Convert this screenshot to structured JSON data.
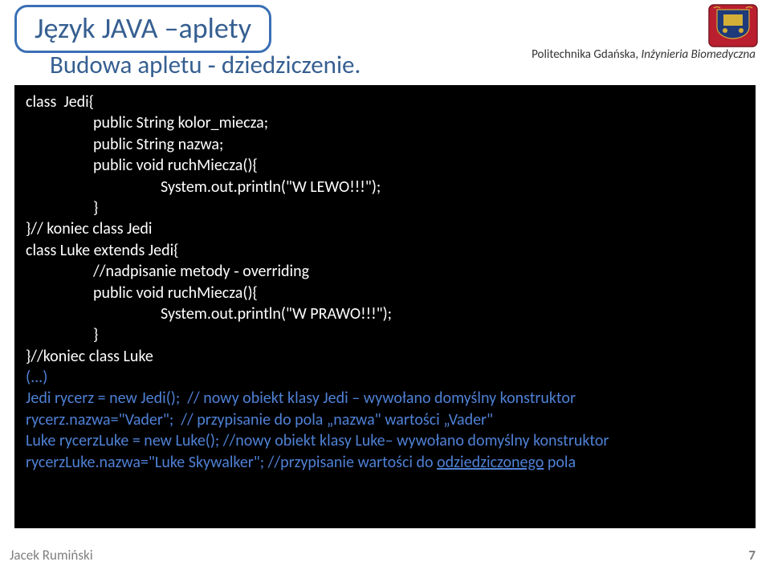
{
  "title": "Język JAVA –aplety",
  "subtitle": "Budowa apletu ‑ dziedziczenie.",
  "institution_plain": "Politechnika Gdańska, ",
  "institution_italic": "Inżynieria Biomedyczna",
  "code": {
    "l1": "class  Jedi{",
    "l2": "public String kolor_miecza;",
    "l3": "public String nazwa;",
    "l4": "public void ruchMiecza(){",
    "l5": "System.out.println(\"W LEWO!!!\");",
    "l6": "}",
    "l7": "}// koniec class Jedi",
    "l8": "class Luke extends Jedi{",
    "l9": "//nadpisanie metody ‑ overriding",
    "l10": "public void ruchMiecza(){",
    "l11": "System.out.println(\"W PRAWO!!!\");",
    "l12": "}",
    "l13": "}//koniec class Luke",
    "l14": "",
    "l15": "(...)",
    "l16": "Jedi rycerz = new Jedi();  // nowy obiekt klasy Jedi – wywołano domyślny konstruktor",
    "l17": "rycerz.nazwa=\"Vader\";  // przypisanie do pola „nazwa\" wartości „Vader\"",
    "l18": "Luke rycerzLuke = new Luke(); //nowy obiekt klasy Luke– wywołano domyślny konstruktor",
    "l19a": "rycerzLuke.nazwa=\"Luke Skywalker\"; //przypisanie wartości do ",
    "l19b": "odziedziczonego",
    "l19c": " pola"
  },
  "footer": {
    "author": "Jacek Rumiński",
    "page": "7"
  }
}
